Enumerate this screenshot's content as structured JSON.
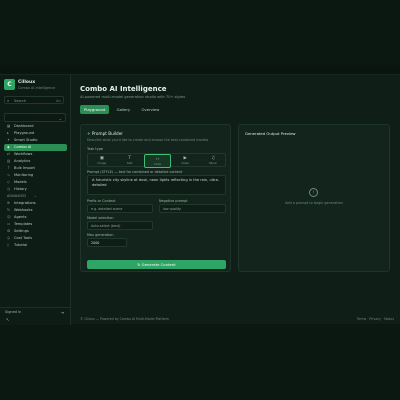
{
  "brand": {
    "logo": "C",
    "name": "Cilloux",
    "subtitle": "Combo AI Intelligence"
  },
  "sidebar": {
    "search_placeholder": "Search",
    "search_shortcut": "⌘K",
    "select_value": "",
    "items": [
      {
        "label": "Dashboard",
        "icon": "grid-icon"
      },
      {
        "label": "Playground",
        "icon": "play-icon"
      },
      {
        "label": "Smart Studio",
        "icon": "spark-icon"
      },
      {
        "label": "Combo AI",
        "icon": "combo-icon",
        "active": true
      },
      {
        "label": "Workflows",
        "icon": "flow-icon"
      },
      {
        "label": "Analytics",
        "icon": "chart-icon"
      },
      {
        "label": "Bulk Import",
        "icon": "upload-icon"
      },
      {
        "label": "Monitoring",
        "icon": "pulse-icon"
      },
      {
        "label": "Models",
        "icon": "cube-icon"
      },
      {
        "label": "History",
        "icon": "clock-icon"
      }
    ],
    "group_label": "ADVANCED",
    "group_items": [
      {
        "label": "Integrations",
        "icon": "plug-icon"
      },
      {
        "label": "Webhooks",
        "icon": "hook-icon"
      },
      {
        "label": "Agents",
        "icon": "bot-icon"
      },
      {
        "label": "Templates",
        "icon": "doc-icon"
      },
      {
        "label": "Settings",
        "icon": "gear-icon"
      },
      {
        "label": "Cost Tools",
        "icon": "coin-icon"
      },
      {
        "label": "Tutorial",
        "icon": "book-icon"
      }
    ],
    "footer_label": "Signed in"
  },
  "main": {
    "title": "Combo AI Intelligence",
    "subtitle": "AI-powered multi-model generation studio with 70+ styles",
    "tabs": [
      {
        "label": "Playground",
        "active": true
      },
      {
        "label": "Gallery"
      },
      {
        "label": "Overview"
      }
    ]
  },
  "form": {
    "title": "Prompt Builder",
    "description": "Describe what you'd like to create and choose the best combined models",
    "type_label": "Task type",
    "types": [
      {
        "label": "Image",
        "icon": "image-icon"
      },
      {
        "label": "Text",
        "icon": "text-icon"
      },
      {
        "label": "Code",
        "icon": "code-icon",
        "active": true
      },
      {
        "label": "Video",
        "icon": "video-icon"
      },
      {
        "label": "Music",
        "icon": "music-icon"
      }
    ],
    "prompt_label": "Prompt (STYLE) — text for combined or detailed content",
    "prompt_value": "A futuristic city skyline at dusk, neon lights reflecting in the rain, ultra-detailed",
    "field_a_label": "Prefix or Context",
    "field_a_placeholder": "e.g. detailed scene",
    "field_b_label": "Negative prompt",
    "field_b_placeholder": "low quality",
    "field_c_label": "Model selection",
    "field_c_placeholder": "Auto-select (best)",
    "field_d_label": "Max generation",
    "field_d_value": "2000",
    "generate_label": "Generate Content"
  },
  "result": {
    "title": "Generated Output Preview",
    "empty_text": "Add a prompt to begin generation"
  },
  "footer": {
    "left": "© Cilloux — Powered by Combo AI Multi-Model Platform",
    "right": "Terms · Privacy · Status"
  }
}
